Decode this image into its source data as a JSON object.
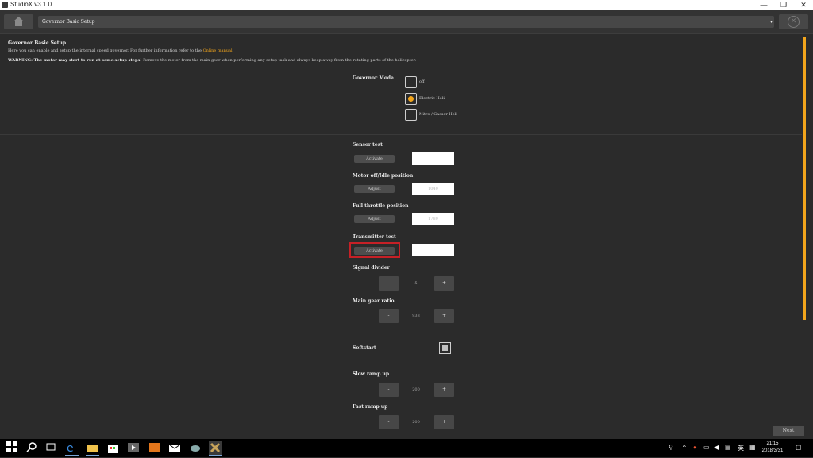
{
  "window": {
    "title": "StudioX v3.1.0",
    "controls": {
      "minimize": "—",
      "maximize": "❐",
      "close": "✕"
    }
  },
  "topbar": {
    "breadcrumb": "Governor Basic Setup",
    "dropdown_glyph": "▾",
    "close_glyph": "✕"
  },
  "header": {
    "title": "Governor Basic Setup",
    "intro": "Here you can enable and setup the internal speed governor. For further information refer to the",
    "manual_link": "Online manual",
    "intro_end": ".",
    "warning_label": "WARNING: The motor may start to run at some setup steps!",
    "warning_text": "Remove the motor from the main gear when performing any setup task and always keep away from the rotating parts of the helicopter."
  },
  "governor_mode": {
    "label": "Governor Mode",
    "options": [
      {
        "label": "off",
        "selected": false
      },
      {
        "label": "Electric Heli",
        "selected": true
      },
      {
        "label": "Nitro / Gasser Heli",
        "selected": false
      }
    ]
  },
  "sensor_test": {
    "label": "Sensor test",
    "button": "Activate",
    "value": ""
  },
  "motor_off": {
    "label": "Motor off/Idle position",
    "button": "Adjust",
    "value": "1040"
  },
  "full_throttle": {
    "label": "Full throttle position",
    "button": "Adjust",
    "value": "1780"
  },
  "transmitter_test": {
    "label": "Transmitter test",
    "button": "Activate",
    "value": ""
  },
  "signal_divider": {
    "label": "Signal divider",
    "minus": "-",
    "value": "5",
    "plus": "+"
  },
  "main_gear_ratio": {
    "label": "Main gear ratio",
    "minus": "-",
    "value": "933",
    "plus": "+"
  },
  "softstart": {
    "label": "Softstart"
  },
  "slow_ramp_up": {
    "label": "Slow ramp up",
    "minus": "-",
    "value": "200",
    "plus": "+"
  },
  "fast_ramp_up": {
    "label": "Fast ramp up",
    "minus": "-",
    "value": "200",
    "plus": "+"
  },
  "footer": {
    "next_label": "Next"
  },
  "taskbar": {
    "time": "21:15",
    "date": "2018/3/31",
    "tray_icons": [
      "people-icon",
      "chevron-up-icon",
      "antivirus-icon",
      "network-icon",
      "volume-icon",
      "keyboard-icon",
      "language-icon",
      "notification-icon"
    ]
  },
  "colors": {
    "accent": "#f2a51c",
    "background": "#2b2b2b",
    "highlight": "#c62026"
  }
}
